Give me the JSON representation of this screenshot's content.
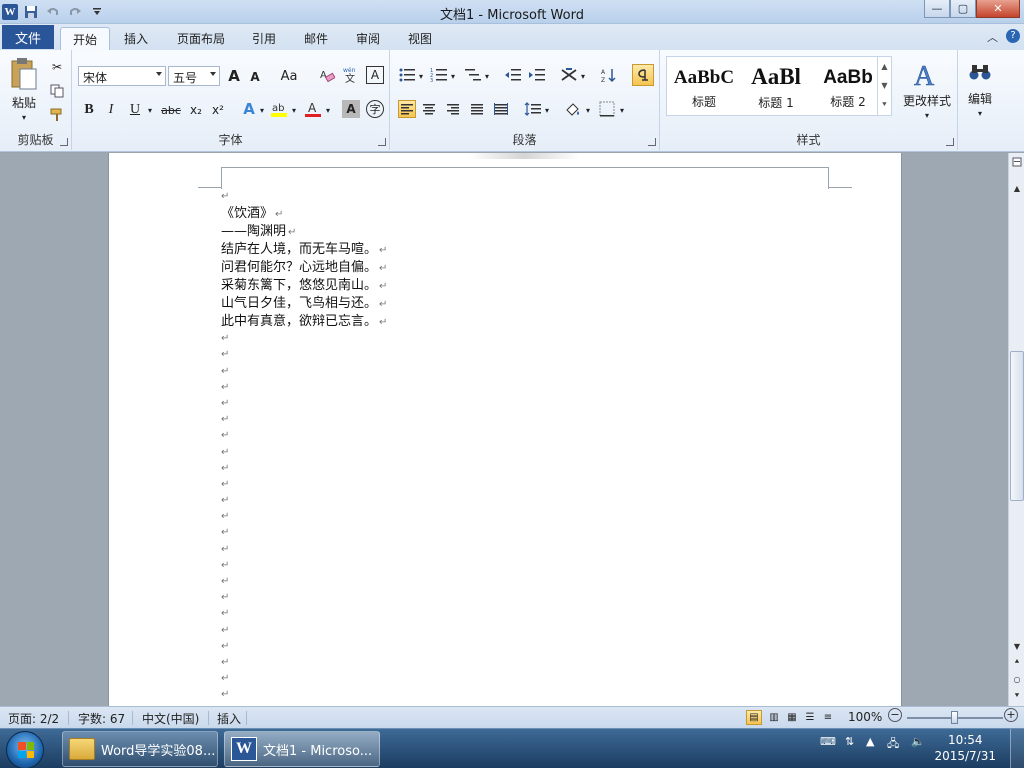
{
  "titlebar": {
    "title": "文档1 - Microsoft Word",
    "app_icon": "W",
    "minimize": "—",
    "maximize": "▢",
    "close": "✕"
  },
  "tabs": {
    "file": "文件",
    "items": [
      "开始",
      "插入",
      "页面布局",
      "引用",
      "邮件",
      "审阅",
      "视图"
    ],
    "active": "开始"
  },
  "ribbon": {
    "clipboard": {
      "label": "剪贴板",
      "paste": "粘贴"
    },
    "font": {
      "label": "字体",
      "font_name": "宋体",
      "font_size": "五号",
      "grow": "A",
      "shrink": "A",
      "case": "Aa",
      "bold": "B",
      "italic": "I",
      "underline": "U",
      "strike": "abc",
      "subscript": "x₂",
      "superscript": "x²",
      "color_a": "A"
    },
    "paragraph": {
      "label": "段落"
    },
    "styles": {
      "label": "样式",
      "items": [
        {
          "sample": "AaBbC",
          "name": "标题"
        },
        {
          "sample": "AaBl",
          "name": "标题 1"
        },
        {
          "sample": "AaBb",
          "name": "标题 2"
        }
      ],
      "change_styles": "更改样式"
    },
    "editing": {
      "label": "编辑"
    }
  },
  "document": {
    "lines": [
      "《饮酒》",
      "——陶渊明",
      "结庐在人境，而无车马喧。",
      "问君何能尔？心远地自偏。",
      "采菊东篱下，悠悠见南山。",
      "山气日夕佳，飞鸟相与还。",
      "此中有真意，欲辩已忘言。"
    ],
    "paragraph_mark": "↵"
  },
  "statusbar": {
    "page": "页面: 2/2",
    "words": "字数: 67",
    "language": "中文(中国)",
    "mode": "插入",
    "zoom": "100%",
    "zoom_minus": "−",
    "zoom_plus": "+"
  },
  "taskbar": {
    "tasks": [
      "Word导学实验08...",
      "文档1 - Microso..."
    ],
    "time": "10:54",
    "date": "2015/7/31"
  },
  "colors": {
    "file_tab": "#2a5699",
    "highlight": "#ffff00",
    "font_color": "#e02020",
    "taskbar": "#1c3d61"
  }
}
